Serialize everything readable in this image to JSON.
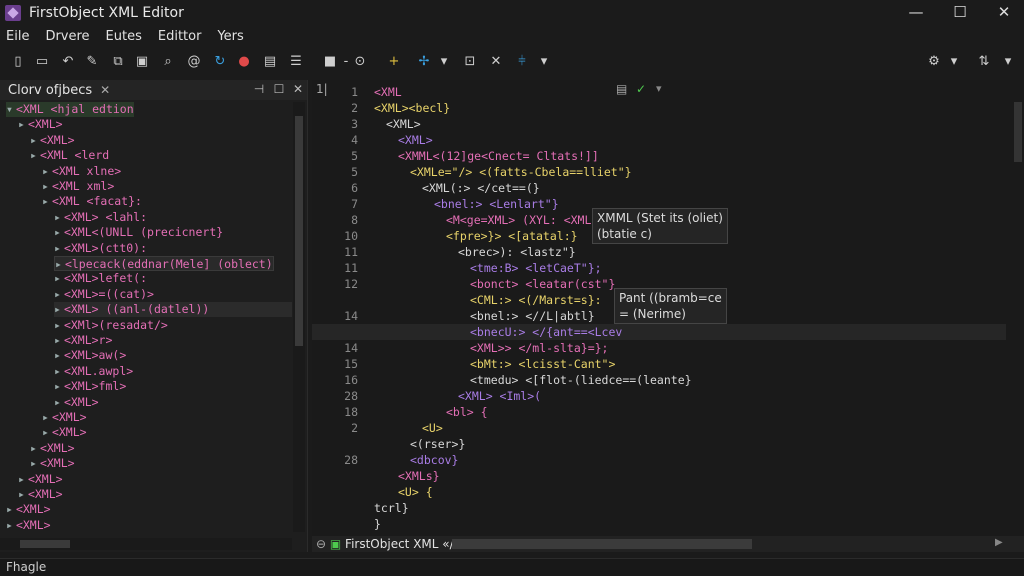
{
  "window": {
    "title": "FirstObject XML Editor",
    "minimize": "—",
    "maximize": "☐",
    "close": "✕"
  },
  "menu": [
    "Eile",
    "Drvere",
    "Eutes",
    "Edittor",
    "Yers"
  ],
  "toolbar_icons": [
    "new-file-icon",
    "open-icon",
    "undo-icon",
    "edit-icon",
    "copy-icon",
    "paste-icon",
    "find-icon",
    "refresh-icon",
    "run-icon",
    "check-icon",
    "list-icon",
    "document-icon",
    "help-icon",
    "add-icon",
    "tools-icon",
    "validate-icon",
    "delete-icon",
    "split-icon",
    "settings-icon",
    "pin-icon"
  ],
  "left_panel": {
    "title": "Clorv ofjbecs",
    "close_label": "✕",
    "tree": [
      {
        "text": "<XML <hjal edtion",
        "level": 0,
        "selected": true
      },
      {
        "text": "<XML>",
        "level": 1
      },
      {
        "text": "<XML>",
        "level": 2
      },
      {
        "text": "<XML <lerd",
        "level": 2
      },
      {
        "text": "<XML xlne>",
        "level": 3
      },
      {
        "text": "<XML xml>",
        "level": 3
      },
      {
        "text": "<XML <facat}:",
        "level": 3
      },
      {
        "text": "<XML> <lahl:",
        "level": 4
      },
      {
        "text": "<XML<(UNLL (precicnert}",
        "level": 4
      },
      {
        "text": "<XML>(ctt0):",
        "level": 4
      },
      {
        "text": "<lpecack(eddnar(Mele] (oblect)",
        "level": 4,
        "highlight": true
      },
      {
        "text": "<XML>lefet(:",
        "level": 4
      },
      {
        "text": "<XML>=((cat)>",
        "level": 4
      },
      {
        "text": "<XML> ((anl-(datlel))",
        "level": 4,
        "current": true
      },
      {
        "text": "<XMl>(resadat/>",
        "level": 4
      },
      {
        "text": "<XML>r>",
        "level": 4
      },
      {
        "text": "<XML>aw(>",
        "level": 4
      },
      {
        "text": "<XML.awpl>",
        "level": 4
      },
      {
        "text": "<XML>fml>",
        "level": 4
      },
      {
        "text": "<XML>",
        "level": 4
      },
      {
        "text": "<XML>",
        "level": 3
      },
      {
        "text": "<XML>",
        "level": 3
      },
      {
        "text": "<XML>",
        "level": 2
      },
      {
        "text": "<XML>",
        "level": 2
      },
      {
        "text": "<XML>",
        "level": 1
      },
      {
        "text": "<XML>",
        "level": 1
      },
      {
        "text": "<XML>",
        "level": 0
      },
      {
        "text": "<XML>",
        "level": 0
      }
    ]
  },
  "editor": {
    "top_line_marker": "1|",
    "line_numbers": [
      "1",
      "2",
      "3",
      "4",
      "5",
      "5",
      "6",
      "7",
      "8",
      "10",
      "11",
      "11",
      "12",
      "",
      "14",
      "",
      "14",
      "15",
      "16",
      "28",
      "18",
      "2",
      "",
      "28"
    ],
    "lines": [
      "<XML",
      "<XML><becl}",
      "<XML>",
      "<XML>",
      "<XMML<(12]ge<Cnect= Cltats!]]",
      "<XMLe=\"/> <(fatts-Cbela==lliet\"}",
      "<XML(:> </cet==(}",
      "<bnel:> <Lenlart\"}",
      "<M<ge=XML> (XYL: <XML",
      "<fpre>}> <[atatal:}",
      "<brec>): <lastz\"}",
      "<tme:B> <letCaeT\"};",
      "<bonct> <leatar(cst\"}",
      "<CML:> <(/Marst=s}:",
      "<bnel:> <//L|abtl}",
      "<bnecU:> </{ant==<Lcev",
      "<XML>> </ml-slta}=};",
      "<bMt:> <lcisst-Cant\">",
      "<tmedu> <[flot-(liedce==(leante}",
      "<XML> <Iml>(",
      "<bl> {",
      "<U>",
      "<(rser>}",
      "<dbcov}",
      "<XMLs}",
      "<U> {",
      "tcrl}",
      "}"
    ],
    "tooltip1_line1": "XMML (Stet its (oliet)",
    "tooltip1_line2": "(btatie c)",
    "tooltip2_line1": "Pant ((bramb=ce",
    "tooltip2_line2": "= (Nerime)"
  },
  "editor_tab": {
    "label": "FirstObject XML «/"
  },
  "status": {
    "text": "Fhagle"
  }
}
